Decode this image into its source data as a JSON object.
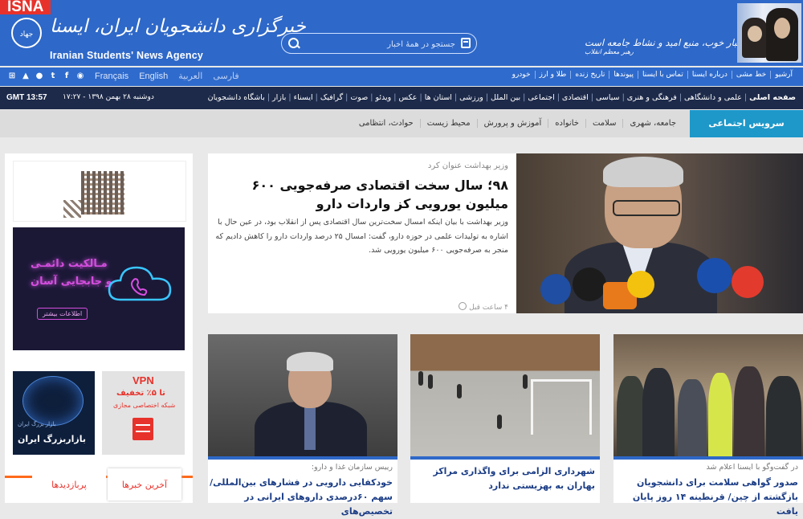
{
  "header": {
    "badge": "ISNA",
    "brand_fa": "خبرگزاری دانشجویان ایران، ایسنا",
    "brand_en": "Iranian Students' News Agency",
    "seal_text": "جهاد",
    "slogan": "اخبار خوب، منبع امید و نشاط جامعه است",
    "slogan_by": "رهبر معظم انقلاب",
    "search_placeholder": "جستجو در همهٔ اخبار"
  },
  "top_nav": {
    "languages": [
      "فارسی",
      "العربية",
      "English",
      "Français"
    ],
    "icons": [
      "windows-icon",
      "android-icon",
      "apple-icon",
      "twitter-icon",
      "facebook-icon",
      "rss-icon"
    ],
    "links": [
      "آرشیو",
      "خط مشی",
      "درباره ایسنا",
      "تماس با ایسنا",
      "پیوندها",
      "تاریخ زنده",
      "طلا و ارز",
      "خودرو"
    ]
  },
  "main_nav": {
    "gmt": "GMT 13:57",
    "date": "دوشنبه ۲۸ بهمن ۱۳۹۸ - ۱۷:۲۷",
    "items": [
      "صفحه اصلی",
      "علمی و دانشگاهی",
      "فرهنگی و هنری",
      "سیاسی",
      "اقتصادی",
      "اجتماعی",
      "بین الملل",
      "ورزشی",
      "استان ها",
      "عکس",
      "ویدئو",
      "صوت",
      "گرافیک",
      "ایسناء",
      "بازار",
      "باشگاه دانشجویان"
    ]
  },
  "sub_nav": {
    "active": "سرویس اجتماعی",
    "items": [
      "جامعه، شهری",
      "سلامت",
      "خانواده",
      "آموزش و پرورش",
      "محیط زیست",
      "حوادث، انتظامی"
    ]
  },
  "ads": {
    "ad1_line1": "مـالکیت دائمـی",
    "ad1_line2": "و جابجایی آسان",
    "ad1_button": "اطلاعات بیشتر",
    "ad2_small": "بازار بزرگ ایران",
    "ad2_title": "بازاربزرگ ایران",
    "ad3_vpn": "VPN",
    "ad3_offer": "تا ۵٪ تخفیف",
    "ad3_desc": "شبکه اختصاصی مجازی"
  },
  "tabs": {
    "latest": "آخرین خبرها",
    "most_viewed": "پربازدیدها"
  },
  "lead_story": {
    "category": "وزیر بهداشت عنوان کرد",
    "title": "۹۸؛ سال سخت اقتصادی صرفه‌جویی ۶۰۰ میلیون یورویی کز واردات دارو",
    "summary": "وزیر بهداشت با بیان اینکه امسال سخت‌ترین سال اقتصادی پس از انقلاب بود، در عین حال با اشاره به تولیدات علمی در حوزه دارو، گفت: امسال ۲۵ درصد واردات دارو را کاهش دادیم که منجر به صرفه‌جویی ۶۰۰ میلیون یورویی شد.",
    "time": "۴ ساعت قبل"
  },
  "cards": [
    {
      "category": "رییس سازمان غذا و دارو:",
      "title": "خودکفایی دارویی در فشارهای بین‌المللی/ سهم ۶۰درصدی داروهای ایرانی در تخصیص‌های"
    },
    {
      "category": "",
      "title": "شهرداری الزامی برای واگذاری مراکز بهاران به بهزیستی ندارد"
    },
    {
      "category": "در گفت‌وگو با ایسنا اعلام شد",
      "title": "صدور گواهی سلامت برای دانشجویان بازگشته از چین/ قرنطینه ۱۴ روز پایان یافت"
    }
  ]
}
